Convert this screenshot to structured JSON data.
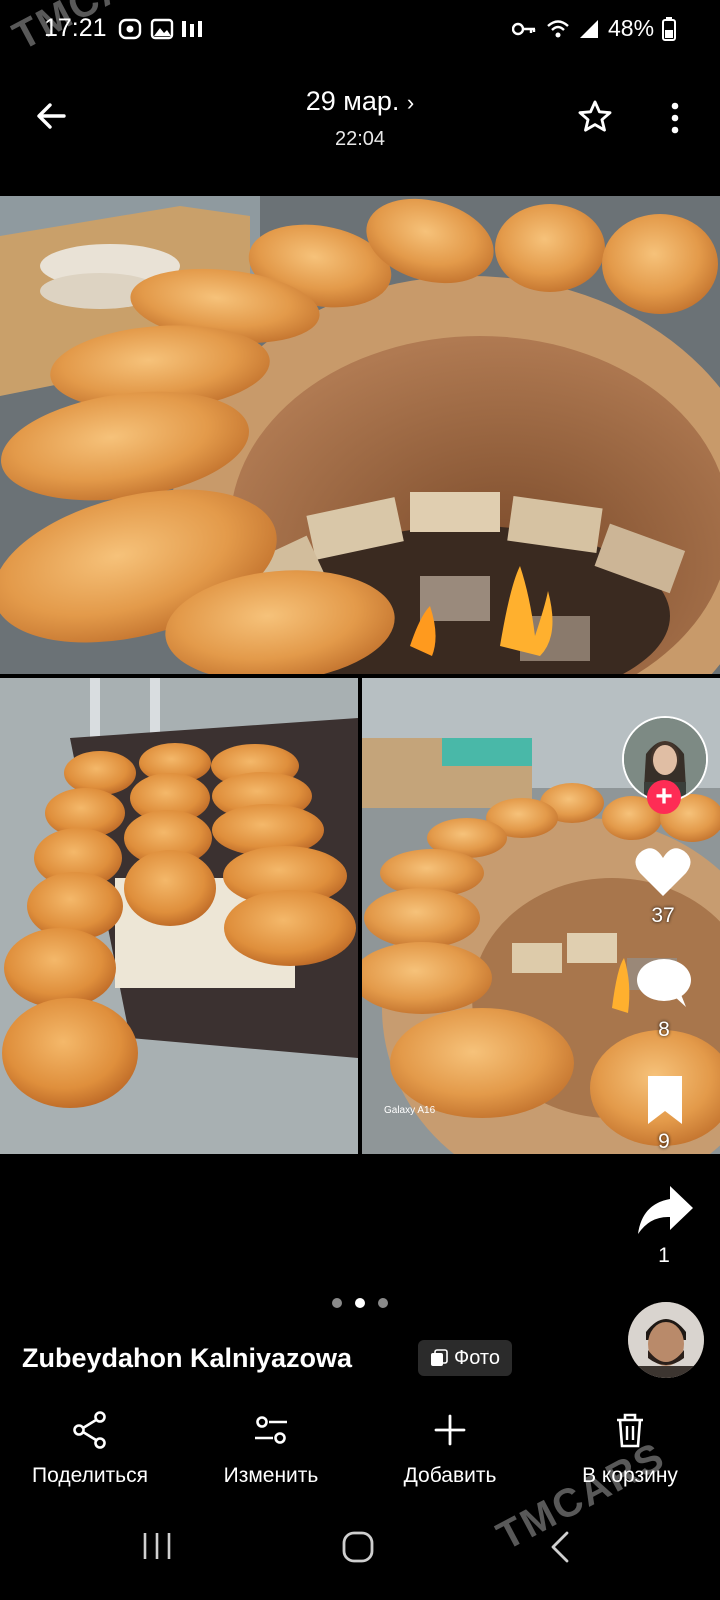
{
  "status_bar": {
    "time": "17:21",
    "battery": "48%"
  },
  "header": {
    "date": "29 мар.",
    "time": "22:04"
  },
  "photos": {
    "watermark_camera": "Galaxy A16"
  },
  "side_actions": {
    "likes": "37",
    "comments": "8",
    "saves": "9",
    "shares": "1"
  },
  "author": {
    "name": "Zubeydahon Kalniyazowa",
    "chip_label": "Фото"
  },
  "actions": {
    "share": "Поделиться",
    "edit": "Изменить",
    "add": "Добавить",
    "delete": "В корзину"
  },
  "watermark": "TMCARS",
  "colors": {
    "like_plus": "#fe2c55",
    "bread": "#e39a4a"
  }
}
